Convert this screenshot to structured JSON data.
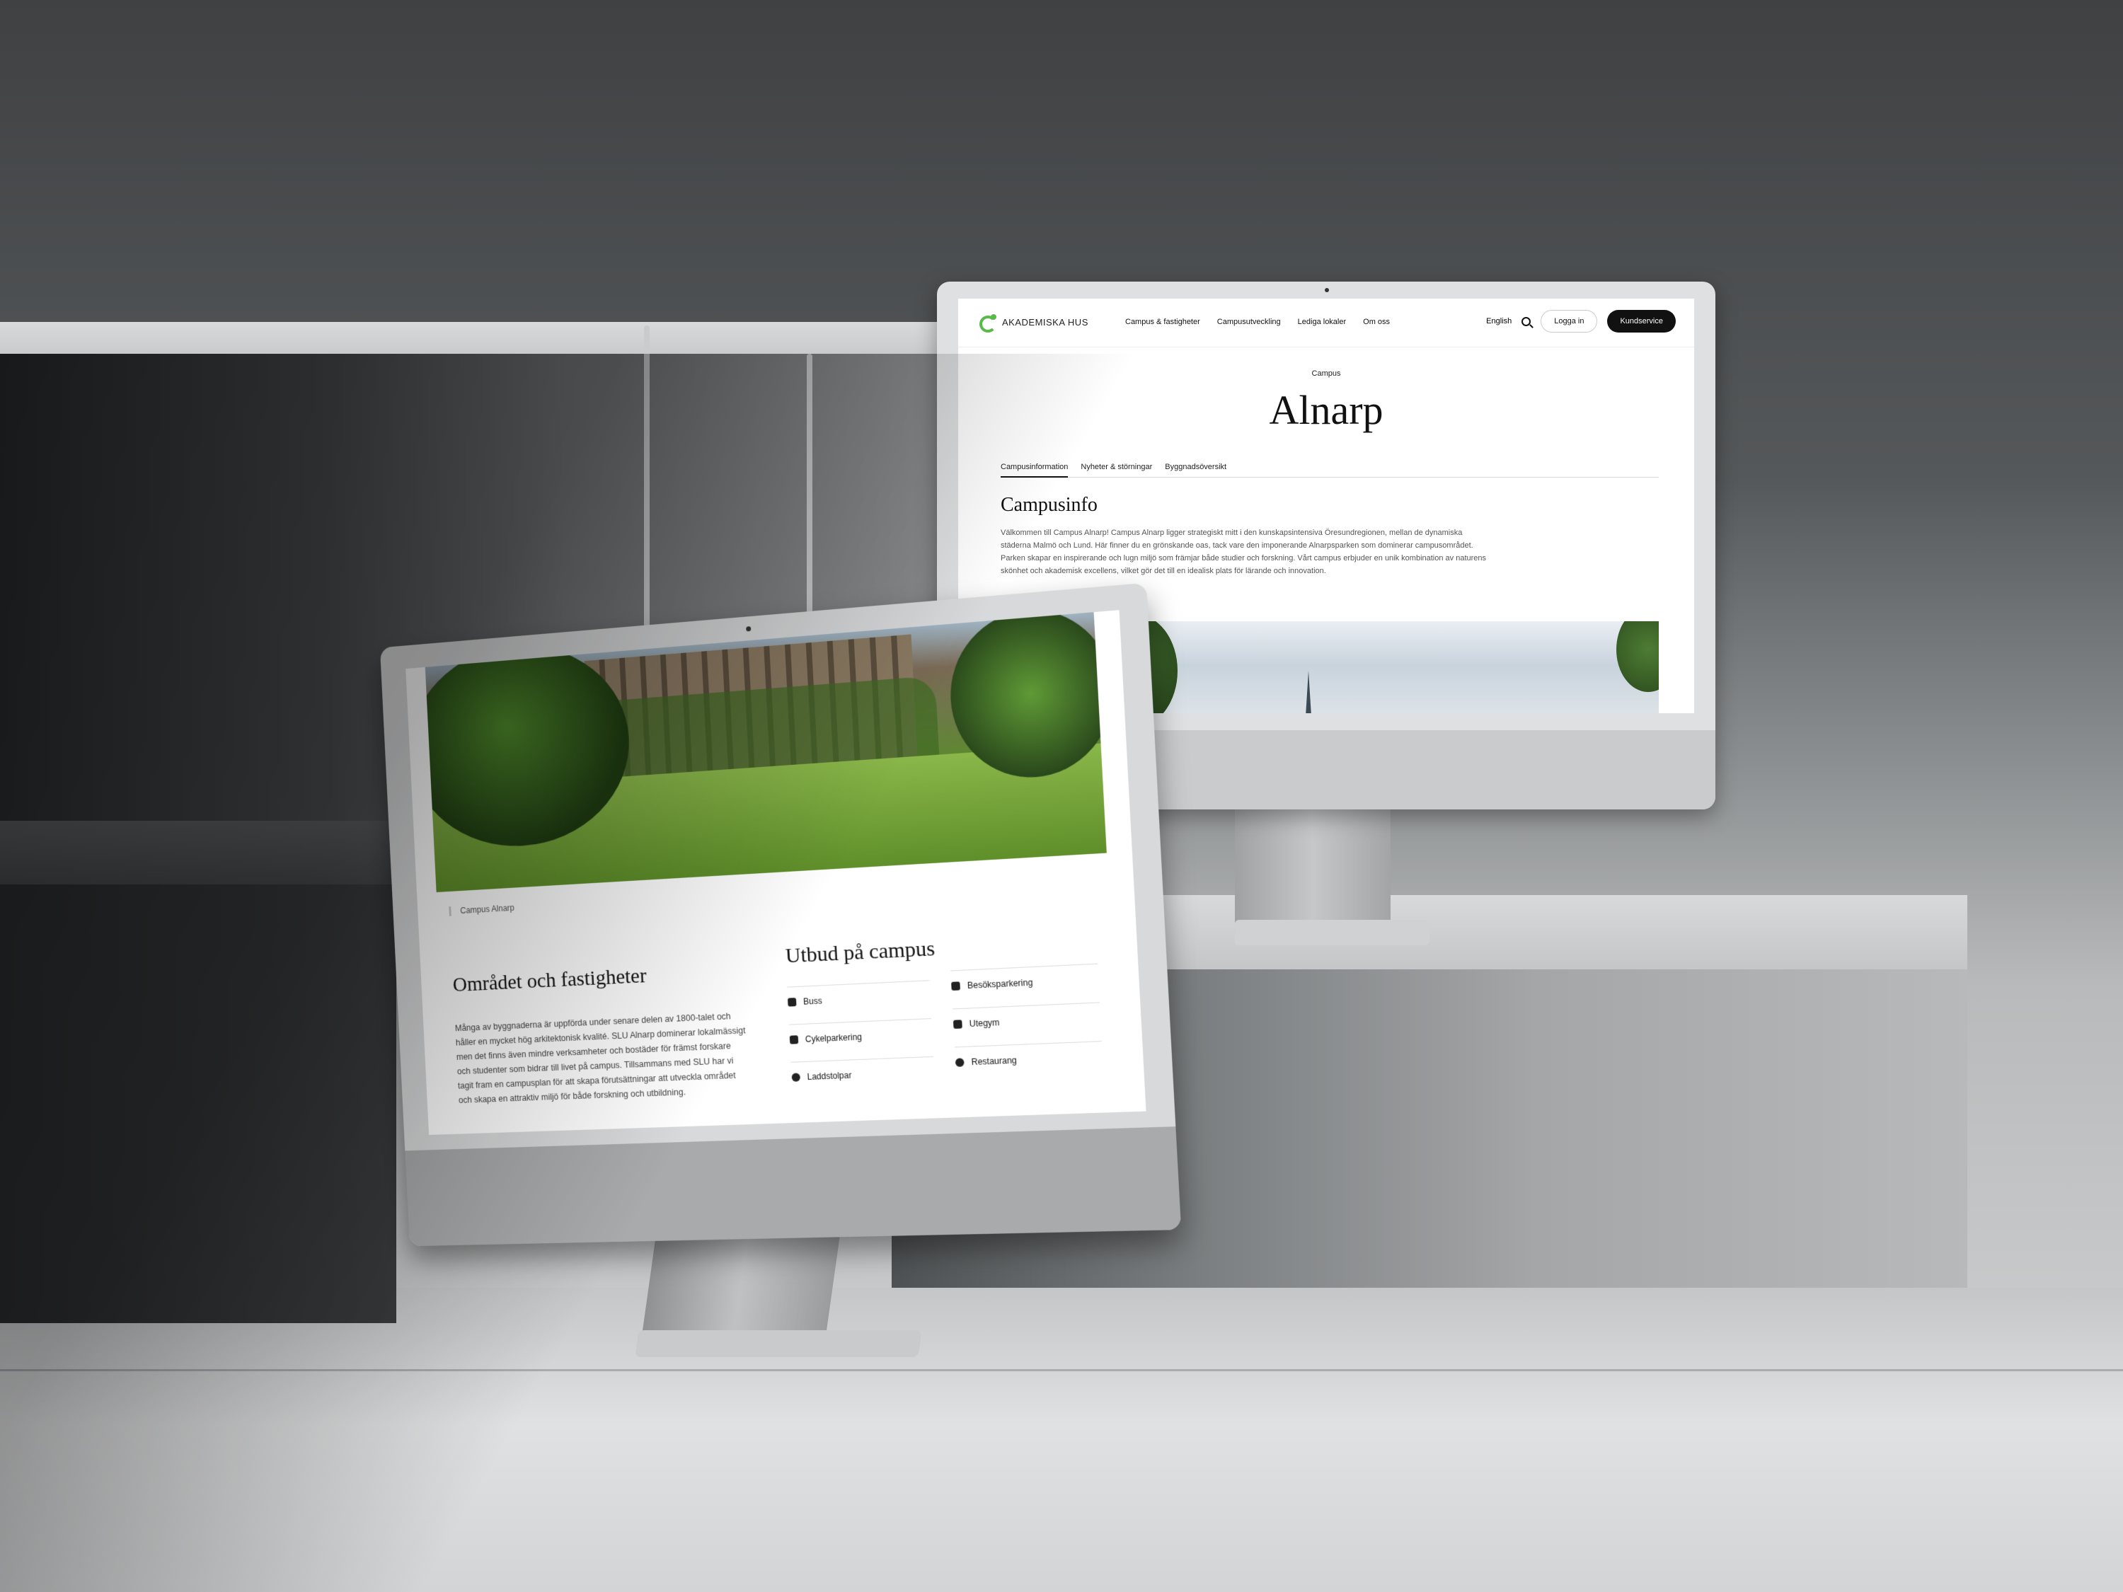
{
  "back_screen": {
    "logo_text": "AKADEMISKA HUS",
    "nav": [
      "Campus & fastigheter",
      "Campusutveckling",
      "Lediga lokaler",
      "Om oss"
    ],
    "language": "English",
    "login_button": "Logga in",
    "service_button": "Kundservice",
    "eyebrow": "Campus",
    "title": "Alnarp",
    "tabs": [
      "Campusinformation",
      "Nyheter & störningar",
      "Byggnadsöversikt"
    ],
    "section_heading": "Campusinfo",
    "paragraph": "Välkommen till Campus Alnarp! Campus Alnarp ligger strategiskt mitt i den kunskapsintensiva Öresundregionen, mellan de dynamiska städerna Malmö och Lund. Här finner du en grönskande oas, tack vare den imponerande Alnarpsparken som dominerar campusområdet. Parken skapar en inspirerande och lugn miljö som främjar både studier och forskning. Vårt campus erbjuder en unik kombination av naturens skönhet och akademisk excellens, vilket gör det till en idealisk plats för lärande och innovation.",
    "accent_color": "#5bb84a"
  },
  "front_screen": {
    "image_caption": "Campus Alnarp",
    "left_heading": "Området och fastigheter",
    "left_paragraph": "Många av byggnaderna är uppförda under senare delen av 1800-talet och håller en mycket hög arkitektonisk kvalité. SLU Alnarp dominerar lokalmässigt men det finns även mindre verksamheter och bostäder för främst forskare och studenter som bidrar till livet på campus. Tillsammans med SLU har vi tagit fram en campusplan för att skapa förutsättningar att utveckla området och skapa en attraktiv miljö för både forskning och utbildning.",
    "right_heading": "Utbud på campus",
    "offerings_left": [
      {
        "icon": "bus-icon",
        "label": "Buss"
      },
      {
        "icon": "parking-icon",
        "label": "Cykelparkering"
      },
      {
        "icon": "charging-icon",
        "label": "Laddstolpar"
      }
    ],
    "offerings_right": [
      {
        "icon": "parking-icon",
        "label": "Besöksparkering"
      },
      {
        "icon": "gym-icon",
        "label": "Utegym"
      },
      {
        "icon": "restaurant-icon",
        "label": "Restaurang"
      }
    ]
  }
}
